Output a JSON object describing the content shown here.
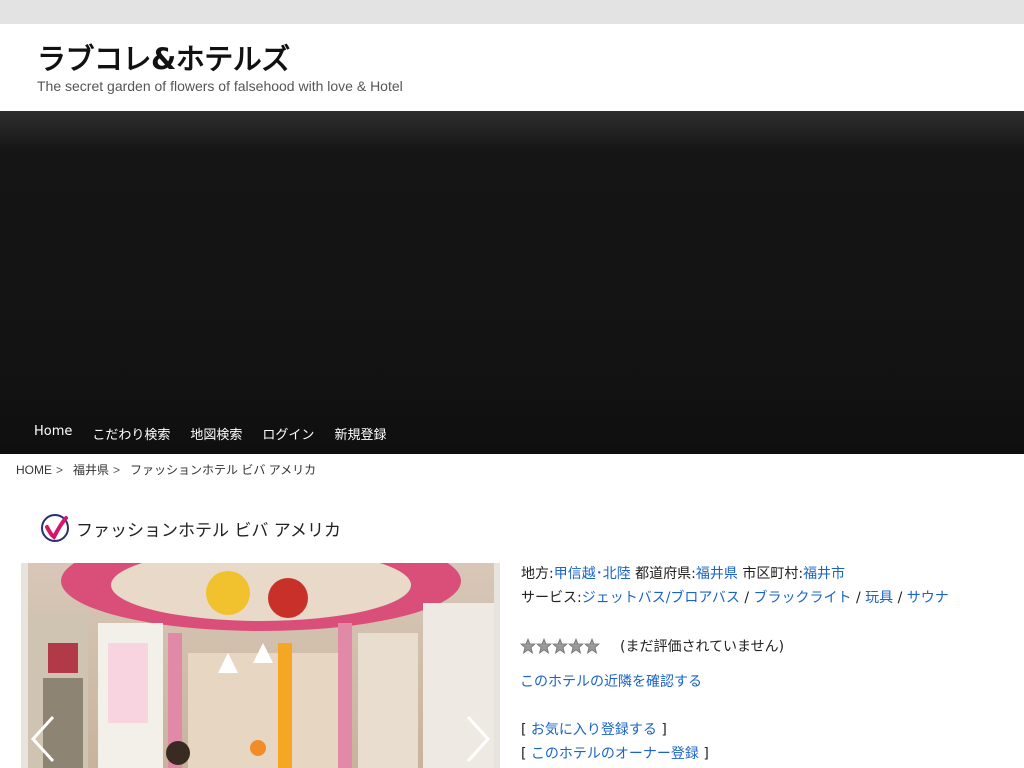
{
  "site": {
    "title": "ラブコレ&ホテルズ",
    "tagline": "The secret garden of flowers of falsehood with love & Hotel"
  },
  "nav": {
    "items": [
      "Home",
      "こだわり検索",
      "地図検索",
      "ログイン",
      "新規登録"
    ]
  },
  "breadcrumb": {
    "home": "HOME",
    "sep": ">",
    "prefecture": "福井県",
    "current": "ファッションホテル ビバ アメリカ"
  },
  "hotel": {
    "icon": "check-swoosh-icon",
    "name": "ファッションホテル ビバ アメリカ"
  },
  "info": {
    "region_label": "地方:",
    "region": "甲信越･北陸",
    "prefecture_label": "都道府県:",
    "prefecture": "福井県",
    "city_label": "市区町村:",
    "city": "福井市",
    "services_label": "サービス:",
    "services": [
      "ジェットバス/ブロアバス",
      "ブラックライト",
      "玩具",
      "サウナ"
    ],
    "service_sep": "/"
  },
  "rating": {
    "stars_filled": 0,
    "stars_total": 5,
    "text": "(まだ評価されていません)"
  },
  "actions": {
    "nearby": "このホテルの近隣を確認する",
    "bracket_open": "[",
    "bracket_close": "]",
    "favorite": "お気に入り登録する",
    "owner": "このホテルのオーナー登録"
  },
  "colors": {
    "link": "#1a63c7",
    "hero": "#131313",
    "topbar": "#e3e3e3"
  }
}
